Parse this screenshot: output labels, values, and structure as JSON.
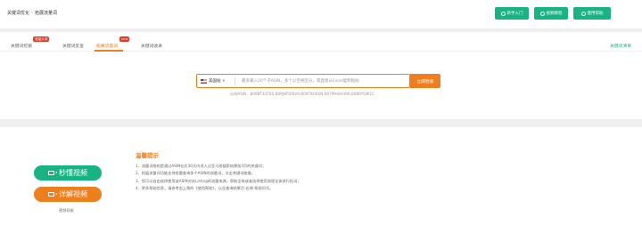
{
  "breadcrumb": {
    "parent": "关键词优化",
    "current": "拓展流量词"
  },
  "top_buttons": [
    {
      "label": "新手入门"
    },
    {
      "label": "视频教程"
    },
    {
      "label": "使用帮助"
    }
  ],
  "tabs": [
    {
      "label": "关键词挖掘",
      "badge": "流量大词"
    },
    {
      "label": "关键词反查",
      "badge": ""
    },
    {
      "label": "拓展流量词",
      "badge": "new"
    },
    {
      "label": "关键词收录",
      "badge": ""
    }
  ],
  "tab_right": "关键词清单",
  "search": {
    "country": "美国站",
    "placeholder": "最多输入20个子ASIN，多个以空格区分，或直接从Excel复制粘贴",
    "button": "立即检索",
    "example_label": "示例ASIN：",
    "example_asins": "B09BT43T85,B09JW5FNV9,B09TKH4SN,B07MH4H39K,B08RYQ8I1C"
  },
  "videos": {
    "quick": "秒懂视频",
    "detail": "详解视频",
    "nav": "视频导航"
  },
  "tips": {
    "title": "温馨提示",
    "items": [
      "1、流量词指的是通过ASIN在近30天内进入过亚马逊搜索结果前3页的关键词；",
      "2、拓展流量词功能支持批量查询多个ASIN的流量词，点击关键词查看；",
      "3、您可以自由选择使用该ASIN对站Listing的流量来源，帮助全体或者选择使用流程全体进行拓词；",
      "4、更多帮助信息，请参考右上角的《使用帮助》，以及查询结果页-右侧-帮助问号。"
    ]
  },
  "colors": {
    "green": "#17b383",
    "orange": "#ef7e1d",
    "badge_red": "#e63a28"
  }
}
